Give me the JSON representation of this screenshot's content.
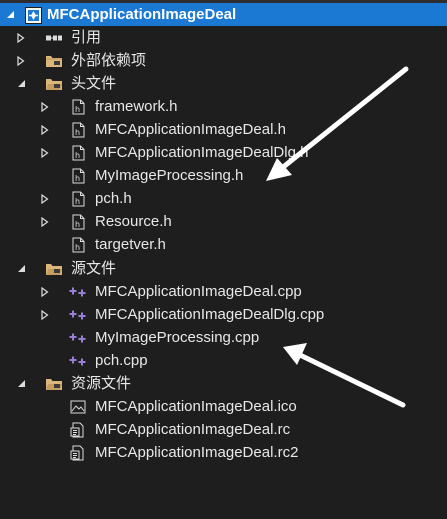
{
  "solution_explorer": {
    "project": {
      "label": "MFCApplicationImageDeal",
      "icon": "project-icon"
    },
    "references": {
      "label": "引用",
      "icon": "references-icon"
    },
    "external_dependencies": {
      "label": "外部依赖项",
      "icon": "external-dependencies-icon"
    },
    "header_files": {
      "label": "头文件",
      "icon": "folder-icon",
      "files": [
        {
          "label": "framework.h",
          "icon": "header-file-icon",
          "expandable": true
        },
        {
          "label": "MFCApplicationImageDeal.h",
          "icon": "header-file-icon",
          "expandable": true
        },
        {
          "label": "MFCApplicationImageDealDlg.h",
          "icon": "header-file-icon",
          "expandable": true
        },
        {
          "label": "MyImageProcessing.h",
          "icon": "header-file-icon",
          "expandable": false
        },
        {
          "label": "pch.h",
          "icon": "header-file-icon",
          "expandable": true
        },
        {
          "label": "Resource.h",
          "icon": "header-file-icon",
          "expandable": true
        },
        {
          "label": "targetver.h",
          "icon": "header-file-icon",
          "expandable": false
        }
      ]
    },
    "source_files": {
      "label": "源文件",
      "icon": "folder-icon",
      "files": [
        {
          "label": "MFCApplicationImageDeal.cpp",
          "icon": "cpp-file-icon",
          "expandable": true
        },
        {
          "label": "MFCApplicationImageDealDlg.cpp",
          "icon": "cpp-file-icon",
          "expandable": true
        },
        {
          "label": "MyImageProcessing.cpp",
          "icon": "cpp-file-icon",
          "expandable": false
        },
        {
          "label": "pch.cpp",
          "icon": "cpp-file-icon",
          "expandable": false
        }
      ]
    },
    "resource_files": {
      "label": "资源文件",
      "icon": "folder-icon",
      "files": [
        {
          "label": "MFCApplicationImageDeal.ico",
          "icon": "image-file-icon"
        },
        {
          "label": "MFCApplicationImageDeal.rc",
          "icon": "resource-file-icon"
        },
        {
          "label": "MFCApplicationImageDeal.rc2",
          "icon": "resource-file-icon"
        }
      ]
    }
  },
  "annotations": {
    "arrows": [
      {
        "name": "annotation-arrow-to-myimageprocessing-h",
        "color": "#ffffff"
      },
      {
        "name": "annotation-arrow-to-myimageprocessing-cpp",
        "color": "#ffffff"
      }
    ]
  },
  "colors": {
    "background": "#1e1e1e",
    "selection": "#1b78d3",
    "text": "#e8e8e8",
    "folder": "#dcb67a",
    "cpp_plus": "#9b7fd6"
  }
}
